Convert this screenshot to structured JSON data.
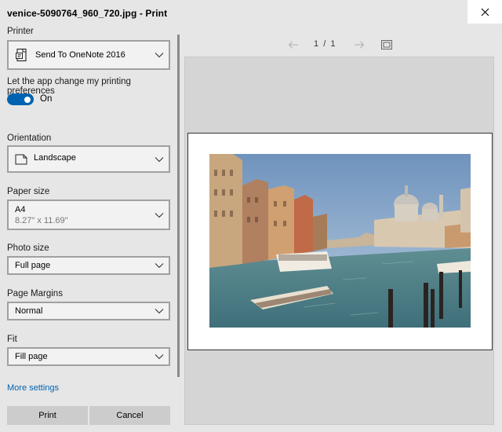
{
  "window": {
    "title": "venice-5090764_960_720.jpg - Print",
    "close_icon": "close-icon"
  },
  "printer": {
    "label": "Printer",
    "value": "Send To OneNote 2016",
    "icon": "printer-document-icon"
  },
  "app_prefs": {
    "label": "Let the app change my printing preferences",
    "state": "On",
    "on": true
  },
  "orientation": {
    "label": "Orientation",
    "value": "Landscape",
    "icon": "page-landscape-icon"
  },
  "paper_size": {
    "label": "Paper size",
    "value": "A4",
    "detail": "8.27\" x 11.69\""
  },
  "photo_size": {
    "label": "Photo size",
    "value": "Full page"
  },
  "page_margins": {
    "label": "Page Margins",
    "value": "Normal"
  },
  "fit": {
    "label": "Fit",
    "value": "Fill page"
  },
  "more_settings": "More settings",
  "buttons": {
    "print": "Print",
    "cancel": "Cancel"
  },
  "preview": {
    "page_indicator": "1  /  1",
    "prev_icon": "arrow-left-icon",
    "next_icon": "arrow-right-icon",
    "fit_icon": "fit-to-window-icon"
  },
  "colors": {
    "accent": "#0063b1",
    "panel_bg": "#e6e6e6",
    "preview_bg": "#d5d5d5"
  }
}
